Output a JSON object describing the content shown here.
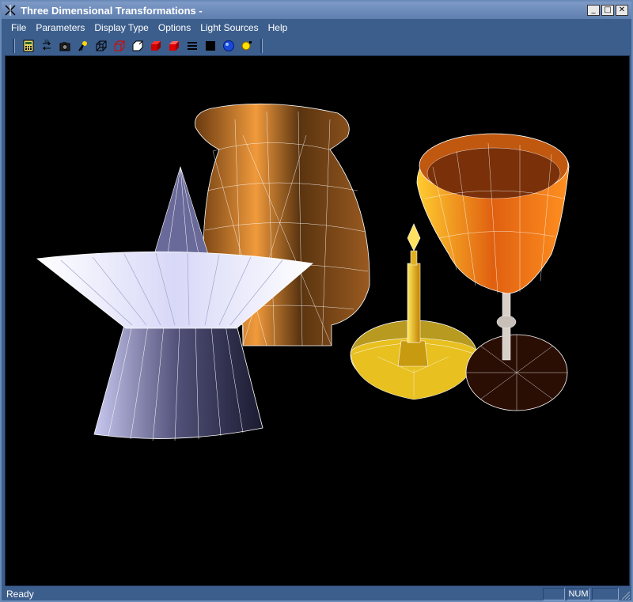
{
  "window": {
    "title": "Three Dimensional Transformations -"
  },
  "menubar": {
    "items": [
      "File",
      "Parameters",
      "Display Type",
      "Options",
      "Light Sources",
      "Help"
    ]
  },
  "toolbar": {
    "buttons": [
      "calculator-icon",
      "rotate-axis-icon",
      "camera-icon",
      "light-source-icon",
      "wireframe-cube-icon",
      "hidden-line-cube-icon",
      "outline-cube-icon",
      "flat-shaded-cube-icon",
      "smooth-shaded-cube-icon",
      "lines-icon",
      "black-square-icon",
      "globe-icon",
      "light-bulb-icon"
    ]
  },
  "statusbar": {
    "text": "Ready",
    "num_indicator": "NUM"
  },
  "colors": {
    "frame": "#3c5e8c",
    "titlebar": "#6f8dbd",
    "viewport_bg": "#000000"
  }
}
